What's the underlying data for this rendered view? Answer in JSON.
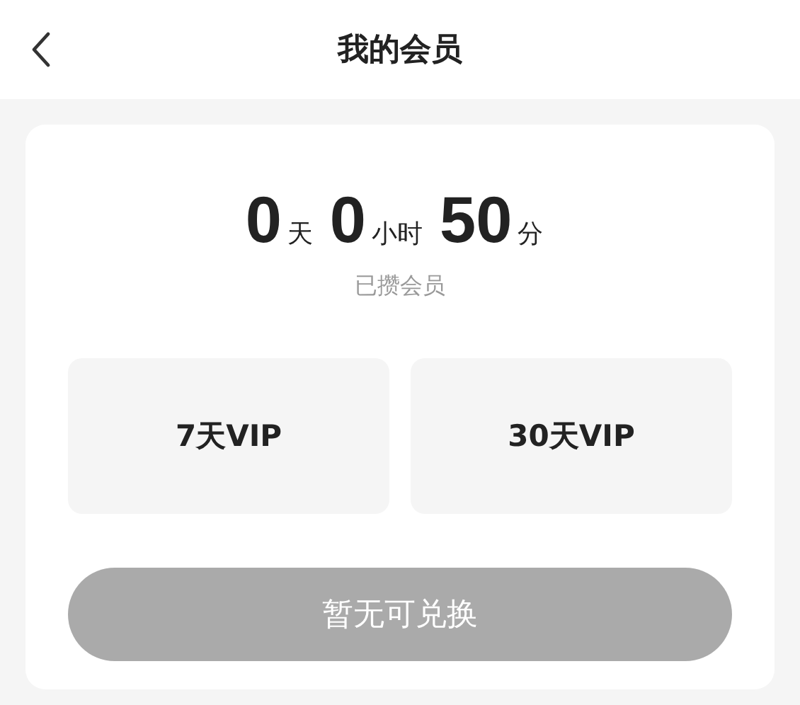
{
  "header": {
    "title": "我的会员"
  },
  "membership": {
    "duration": [
      {
        "value": "0",
        "unit": "天"
      },
      {
        "value": "0",
        "unit": "小时"
      },
      {
        "value": "50",
        "unit": "分"
      }
    ],
    "caption": "已攒会员"
  },
  "plans": [
    {
      "label": "7天VIP",
      "selected": false
    },
    {
      "label": "30天VIP",
      "selected": false
    }
  ],
  "redeem_button": {
    "label": "暂无可兑换",
    "disabled": true
  }
}
